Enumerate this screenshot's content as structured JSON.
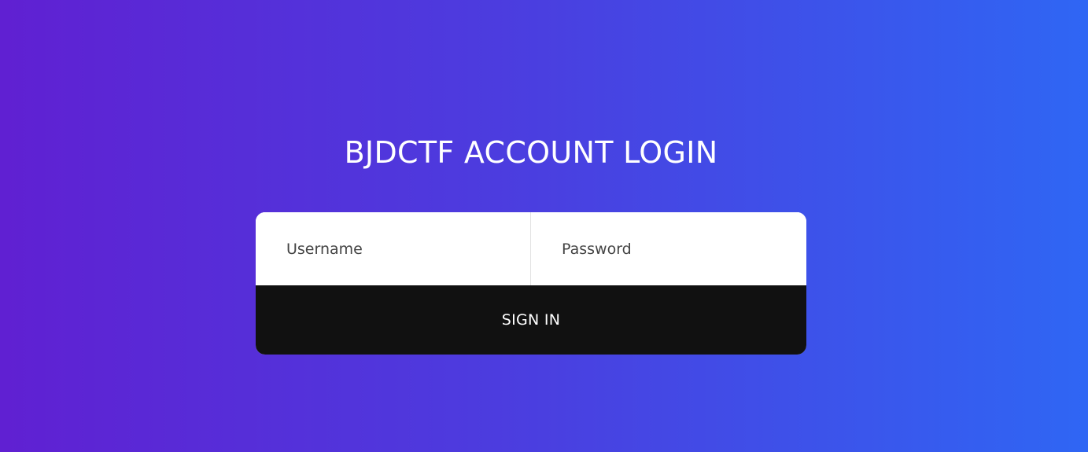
{
  "header": {
    "title": "BJDCTF ACCOUNT LOGIN"
  },
  "form": {
    "username_placeholder": "Username",
    "username_value": "",
    "password_placeholder": "Password",
    "password_value": "",
    "submit_label": "SIGN IN"
  },
  "colors": {
    "gradient_start": "#6020d2",
    "gradient_end": "#2f66f4",
    "button_background": "#111111",
    "field_background": "#ffffff"
  }
}
